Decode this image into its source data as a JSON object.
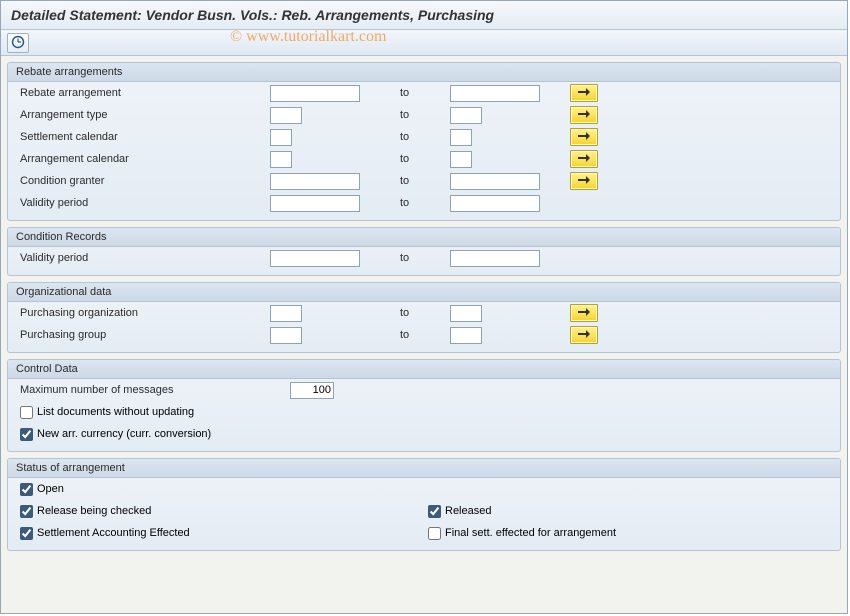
{
  "title": "Detailed Statement: Vendor Busn. Vols.: Reb. Arrangements, Purchasing",
  "watermark": "© www.tutorialkart.com",
  "to_label": "to",
  "groups": {
    "rebate": {
      "title": "Rebate arrangements",
      "rows": {
        "rebate_arrangement": "Rebate arrangement",
        "arrangement_type": "Arrangement type",
        "settlement_calendar": "Settlement calendar",
        "arrangement_calendar": "Arrangement calendar",
        "condition_granter": "Condition granter",
        "validity_period": "Validity period"
      }
    },
    "cond": {
      "title": "Condition Records",
      "rows": {
        "validity_period": "Validity period"
      }
    },
    "org": {
      "title": "Organizational data",
      "rows": {
        "purch_org": "Purchasing organization",
        "purch_group": "Purchasing group"
      }
    },
    "ctrl": {
      "title": "Control Data",
      "max_messages_label": "Maximum number of messages",
      "max_messages_value": "100",
      "list_docs": "List documents without updating",
      "new_arr_curr": "New arr. currency (curr. conversion)"
    },
    "status": {
      "title": "Status of arrangement",
      "open": "Open",
      "release_checked": "Release being checked",
      "released": "Released",
      "settlement_eff": "Settlement Accounting Effected",
      "final_sett": "Final sett. effected for arrangement"
    }
  }
}
